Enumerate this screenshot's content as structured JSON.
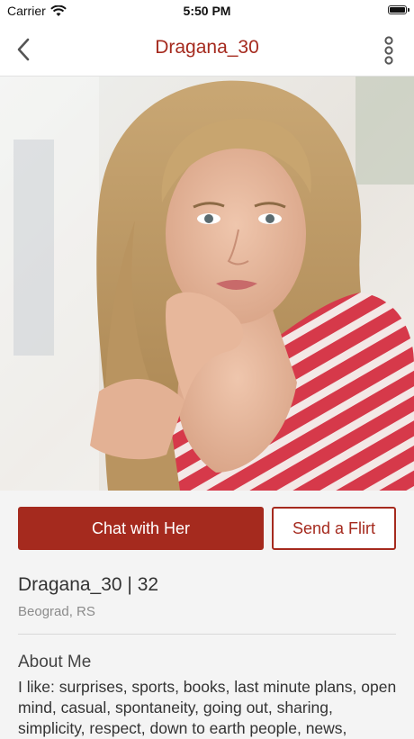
{
  "status_bar": {
    "carrier": "Carrier",
    "time": "5:50 PM"
  },
  "nav": {
    "title": "Dragana_30",
    "back_icon": "chevron-left-icon",
    "more_icon": "more-vertical-icon"
  },
  "actions": {
    "chat_label": "Chat with Her",
    "flirt_label": "Send a Flirt"
  },
  "profile": {
    "name_age": "Dragana_30 | 32",
    "location": "Beograd, RS",
    "about_heading": "About Me",
    "about_text": "I like: surprises, sports, books, last minute plans, open mind, casual, spontaneity, going out, sharing, simplicity, respect, down to earth people, news,"
  },
  "colors": {
    "accent": "#a52a1e",
    "background": "#f4f4f4"
  }
}
